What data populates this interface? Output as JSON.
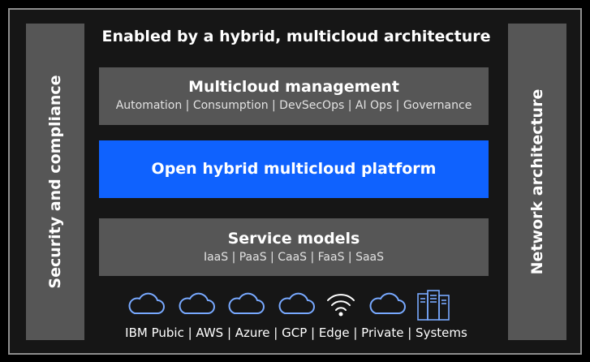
{
  "title": "Enabled by a hybrid, multicloud architecture",
  "left_bar": {
    "label": "Security and compliance"
  },
  "right_bar": {
    "label": "Network architecture"
  },
  "layers": {
    "management": {
      "title": "Multicloud management",
      "subtitle": "Automation | Consumption | DevSecOps | AI Ops | Governance"
    },
    "platform": {
      "title": "Open hybrid multicloud platform"
    },
    "service": {
      "title": "Service models",
      "subtitle": "IaaS | PaaS | CaaS | FaaS | SaaS"
    }
  },
  "icons": [
    "cloud-icon",
    "cloud-icon",
    "cloud-icon",
    "cloud-icon",
    "wifi-icon",
    "cloud-icon",
    "server-icon"
  ],
  "footer": "IBM Pubic | AWS | Azure | GCP | Edge | Private | Systems",
  "colors": {
    "background": "#000000",
    "panel": "#161616",
    "layer": "#565656",
    "accent": "#0f62fe",
    "icon_stroke": "#78a9ff"
  }
}
